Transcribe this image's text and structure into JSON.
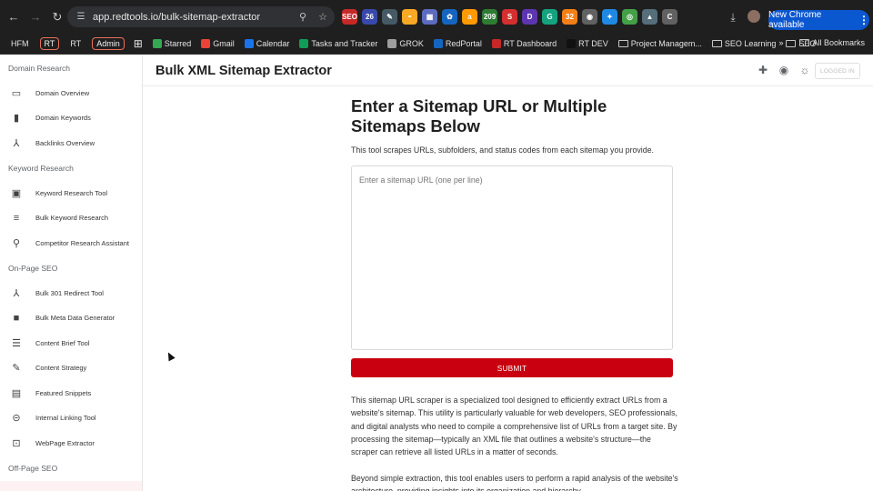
{
  "browser": {
    "url": "app.redtools.io/bulk-sitemap-extractor",
    "update_label": "New Chrome available",
    "extensions": [
      {
        "name": "seo-ext",
        "text": "SEO",
        "color": "#c62828"
      },
      {
        "name": "badge-26-ext",
        "text": "26",
        "color": "#3949ab"
      },
      {
        "name": "pen-ext",
        "text": "✎",
        "color": "#455a64"
      },
      {
        "name": "grammar-ext",
        "text": "◓",
        "color": "#f9a825"
      },
      {
        "name": "doc-ext",
        "text": "▦",
        "color": "#5c6bc0"
      },
      {
        "name": "gear-blue-ext",
        "text": "✿",
        "color": "#1565c0"
      },
      {
        "name": "amazon-ext",
        "text": "a",
        "color": "#ff9900"
      },
      {
        "name": "count-ext",
        "text": "209",
        "color": "#2e7d32"
      },
      {
        "name": "s-ext",
        "text": "S",
        "color": "#d32f2f"
      },
      {
        "name": "d-ext",
        "text": "D",
        "color": "#5e35b1"
      },
      {
        "name": "g-ext",
        "text": "G",
        "color": "#15a37f"
      },
      {
        "name": "badge-32-ext",
        "text": "32",
        "color": "#f57f17"
      },
      {
        "name": "camera-ext",
        "text": "◉",
        "color": "#616161"
      },
      {
        "name": "star-ext",
        "text": "✦",
        "color": "#1e88e5"
      },
      {
        "name": "ring-ext",
        "text": "◎",
        "color": "#43a047"
      },
      {
        "name": "tri-ext",
        "text": "▲",
        "color": "#546e7a"
      },
      {
        "name": "c-ext",
        "text": "C",
        "color": "#616161"
      }
    ]
  },
  "bookmarks": {
    "items": [
      {
        "label": "HFM",
        "style": "plain"
      },
      {
        "label": "RT",
        "style": "boxed"
      },
      {
        "label": "RT",
        "style": "plain"
      },
      {
        "label": "Admin",
        "style": "boxed"
      }
    ],
    "links": [
      {
        "label": "Starred",
        "icon": "drive-icon",
        "color": "#34a853"
      },
      {
        "label": "Gmail",
        "icon": "gmail-icon",
        "color": "#ea4335"
      },
      {
        "label": "Calendar",
        "icon": "calendar-icon",
        "color": "#1a73e8"
      },
      {
        "label": "Tasks and Tracker",
        "icon": "sheets-icon",
        "color": "#0f9d58"
      },
      {
        "label": "GROK",
        "icon": "grok-icon",
        "color": "#9e9e9e"
      },
      {
        "label": "RedPortal",
        "icon": "redportal-icon",
        "color": "#1565c0"
      },
      {
        "label": "RT Dashboard",
        "icon": "rt-icon",
        "color": "#c62828"
      },
      {
        "label": "RT DEV",
        "icon": "rtdev-icon",
        "color": "#111111"
      },
      {
        "label": "Project Managem...",
        "icon": "folder-icon",
        "color": ""
      },
      {
        "label": "SEO Learning",
        "icon": "folder-icon",
        "color": ""
      },
      {
        "label": "SEO",
        "icon": "folder-icon",
        "color": ""
      }
    ],
    "all_label": "All Bookmarks",
    "more_label": "»"
  },
  "header": {
    "title": "Bulk XML Sitemap Extractor",
    "login_label": "LOGGED IN"
  },
  "sidebar": {
    "sections": [
      {
        "title": "Domain Research",
        "items": [
          {
            "label": "Domain Overview",
            "icon": "monitor-icon",
            "glyph": "▭"
          },
          {
            "label": "Domain Keywords",
            "icon": "bar-chart-icon",
            "glyph": "▮"
          },
          {
            "label": "Backlinks Overview",
            "icon": "network-icon",
            "glyph": "⅄"
          }
        ]
      },
      {
        "title": "Keyword Research",
        "items": [
          {
            "label": "Keyword Research Tool",
            "icon": "image-search-icon",
            "glyph": "▣"
          },
          {
            "label": "Bulk Keyword Research",
            "icon": "list-icon",
            "glyph": "≡"
          },
          {
            "label": "Competitor Research Assistant",
            "icon": "search-icon",
            "glyph": "⚲"
          }
        ]
      },
      {
        "title": "On-Page SEO",
        "items": [
          {
            "label": "Bulk 301 Redirect Tool",
            "icon": "merge-icon",
            "glyph": "⅄"
          },
          {
            "label": "Bulk Meta Data Generator",
            "icon": "box-icon",
            "glyph": "■"
          },
          {
            "label": "Content Brief Tool",
            "icon": "checklist-icon",
            "glyph": "☰"
          },
          {
            "label": "Content Strategy",
            "icon": "pencil-icon",
            "glyph": "✎"
          },
          {
            "label": "Featured Snippets",
            "icon": "comment-icon",
            "glyph": "▤"
          },
          {
            "label": "Internal Linking Tool",
            "icon": "link-icon",
            "glyph": "⊝"
          },
          {
            "label": "WebPage Extractor",
            "icon": "crop-icon",
            "glyph": "⊡"
          }
        ]
      },
      {
        "title": "Off-Page SEO",
        "items": []
      }
    ]
  },
  "main": {
    "heading": "Enter a Sitemap URL or Multiple Sitemaps Below",
    "subtext": "This tool scrapes URLs, subfolders, and status codes from each sitemap you provide.",
    "input_placeholder": "Enter a sitemap URL (one per line)",
    "input_value": "",
    "submit_label": "SUBMIT",
    "paragraph1": "This sitemap URL scraper is a specialized tool designed to efficiently extract URLs from a website's sitemap. This utility is particularly valuable for web developers, SEO professionals, and digital analysts who need to compile a comprehensive list of URLs from a target site. By processing the sitemap—typically an XML file that outlines a website's structure—the scraper can retrieve all listed URLs in a matter of seconds.",
    "paragraph2": "Beyond simple extraction, this tool enables users to perform a rapid analysis of the website's architecture, providing insights into its organization and hierarchy."
  },
  "colors": {
    "accent": "#c8000f",
    "chrome_bg": "#1f1f1f",
    "update_pill": "#0b57d0"
  }
}
